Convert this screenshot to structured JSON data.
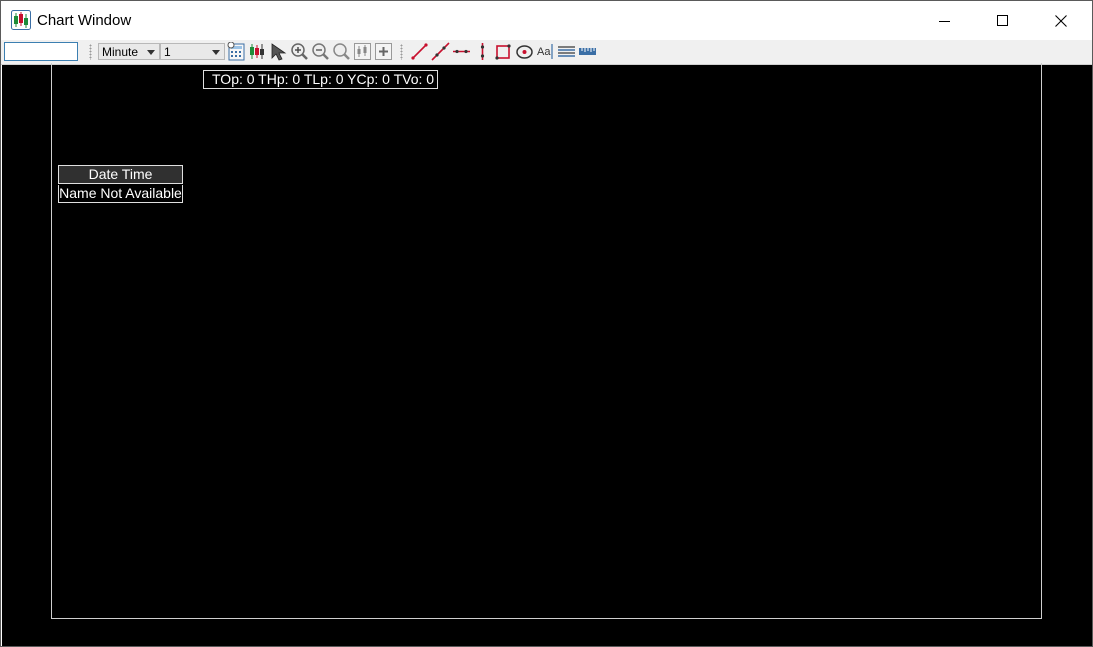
{
  "window": {
    "title": "Chart Window"
  },
  "titlebar_icons": {
    "app": "candlestick-app-icon",
    "minimize": "minimize-icon",
    "maximize": "maximize-icon",
    "close": "close-icon"
  },
  "toolbar": {
    "symbol_value": "",
    "interval_selected": "Minute",
    "interval_count_selected": "1",
    "tools": [
      "calculator-icon",
      "candlestick-icon",
      "pointer-icon",
      "zoom-in-icon",
      "zoom-out-icon",
      "zoom-reset-icon",
      "fit-chart-icon",
      "add-icon",
      "trend-line-icon",
      "ray-line-icon",
      "horizontal-line-icon",
      "vertical-line-icon",
      "rectangle-icon",
      "ellipse-icon",
      "text-tool-icon",
      "fibonacci-icon",
      "ruler-icon"
    ]
  },
  "chart": {
    "ohlc_readout": "TOp: 0 THp: 0 TLp: 0 YCp: 0 TVo: 0",
    "info_date_time": "Date Time",
    "info_name": "Name Not Available"
  },
  "colors": {
    "chart_background": "#000000",
    "frame": "#cfcfcf",
    "accent_red": "#c8102e",
    "accent_green": "#1e8c3a"
  }
}
